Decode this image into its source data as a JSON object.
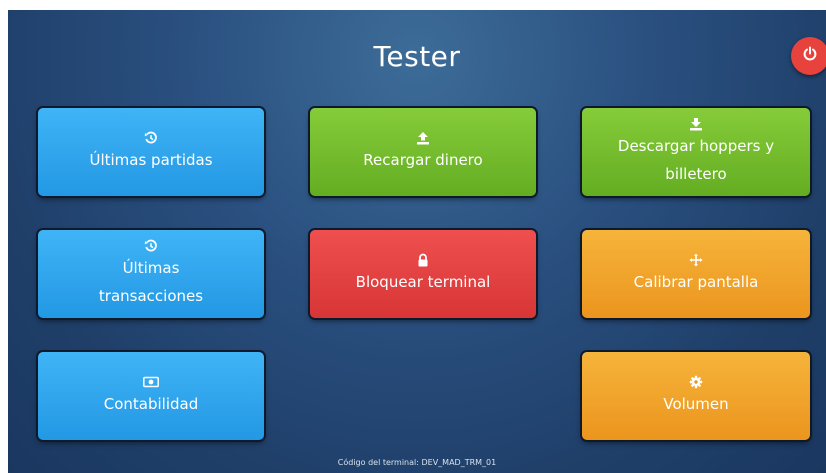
{
  "screen": {
    "title": "Tester",
    "power_icon": "power-icon"
  },
  "tiles": {
    "ultimas_partidas": {
      "label": "Últimas partidas",
      "icon": "history-icon",
      "color": "#2ca5ee"
    },
    "recargar_dinero": {
      "label": "Recargar dinero",
      "icon": "upload-icon",
      "color": "#76bf2e"
    },
    "descargar": {
      "label": "Descargar hoppers y billetero",
      "icon": "download-icon",
      "color": "#76bf2e"
    },
    "ultimas_transacciones": {
      "label": "Últimas transacciones",
      "icon": "history-icon",
      "color": "#2ca5ee"
    },
    "bloquear_terminal": {
      "label": "Bloquear terminal",
      "icon": "lock-icon",
      "color": "#e04444"
    },
    "calibrar_pantalla": {
      "label": "Calibrar pantalla",
      "icon": "move-arrows-icon",
      "color": "#f2a52c"
    },
    "contabilidad": {
      "label": "Contabilidad",
      "icon": "banknote-icon",
      "color": "#2ca5ee"
    },
    "volumen": {
      "label": "Volumen",
      "icon": "gear-icon",
      "color": "#f2a52c"
    }
  },
  "footer": {
    "terminal_code": "Código del terminal: DEV_MAD_TRM_01"
  }
}
